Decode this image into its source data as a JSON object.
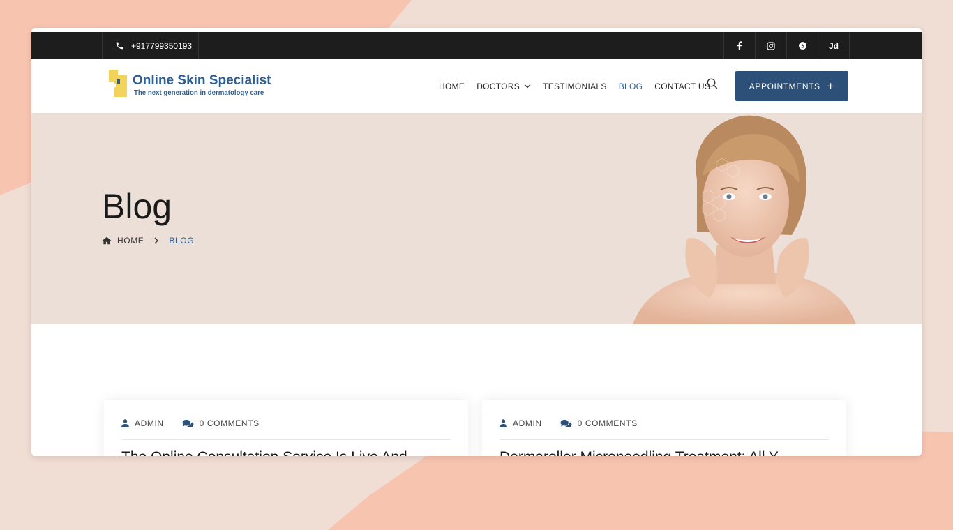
{
  "topbar": {
    "phone": "+917799350193",
    "socials": [
      {
        "icon": "facebook-icon",
        "label": "f"
      },
      {
        "icon": "instagram-icon",
        "label": ""
      },
      {
        "icon": "skype-icon",
        "label": ""
      },
      {
        "icon": "justdial-icon",
        "label": "Jd"
      }
    ]
  },
  "header": {
    "logo_title": "Online Skin Specialist",
    "logo_subtitle": "The next generation in dermatology care",
    "nav": [
      {
        "label": "HOME"
      },
      {
        "label": "DOCTORS"
      },
      {
        "label": "TESTIMONIALS"
      },
      {
        "label": "BLOG"
      },
      {
        "label": "CONTACT US"
      }
    ],
    "appointments_label": "APPOINTMENTS",
    "appointments_icon": "+"
  },
  "hero": {
    "title": "Blog",
    "breadcrumb": {
      "home": "HOME",
      "current": "BLOG"
    }
  },
  "posts": [
    {
      "author": "ADMIN",
      "comments": "0 COMMENTS",
      "title": "The Online Consultation Service Is Live And..."
    },
    {
      "author": "ADMIN",
      "comments": "0 COMMENTS",
      "title": "Dermaroller Microneedling Treatment: All Y..."
    }
  ],
  "colors": {
    "accent": "#2c5e94",
    "button": "#2c5078",
    "topbar": "#1d1d1d",
    "hero_bg": "#ebdfd7",
    "page_bg": "#f0ddd3",
    "blob": "#f7c4b0"
  }
}
